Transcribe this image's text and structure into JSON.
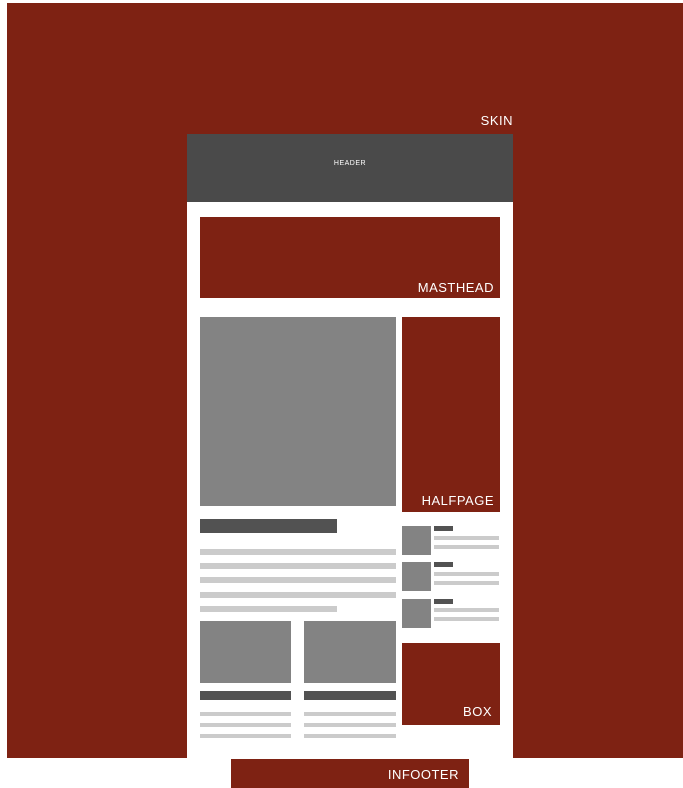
{
  "labels": {
    "skin": "SKIN",
    "header": "HEADER",
    "masthead": "MASTHEAD",
    "halfpage": "HALFPAGE",
    "box": "BOX",
    "infooter": "INFOOTER"
  },
  "colors": {
    "ad_slot": "#7e2213",
    "header": "#4a4a4a",
    "image_placeholder": "#838383",
    "title_bar": "#525252",
    "text_line": "#cbcbcb",
    "page": "#ffffff"
  }
}
